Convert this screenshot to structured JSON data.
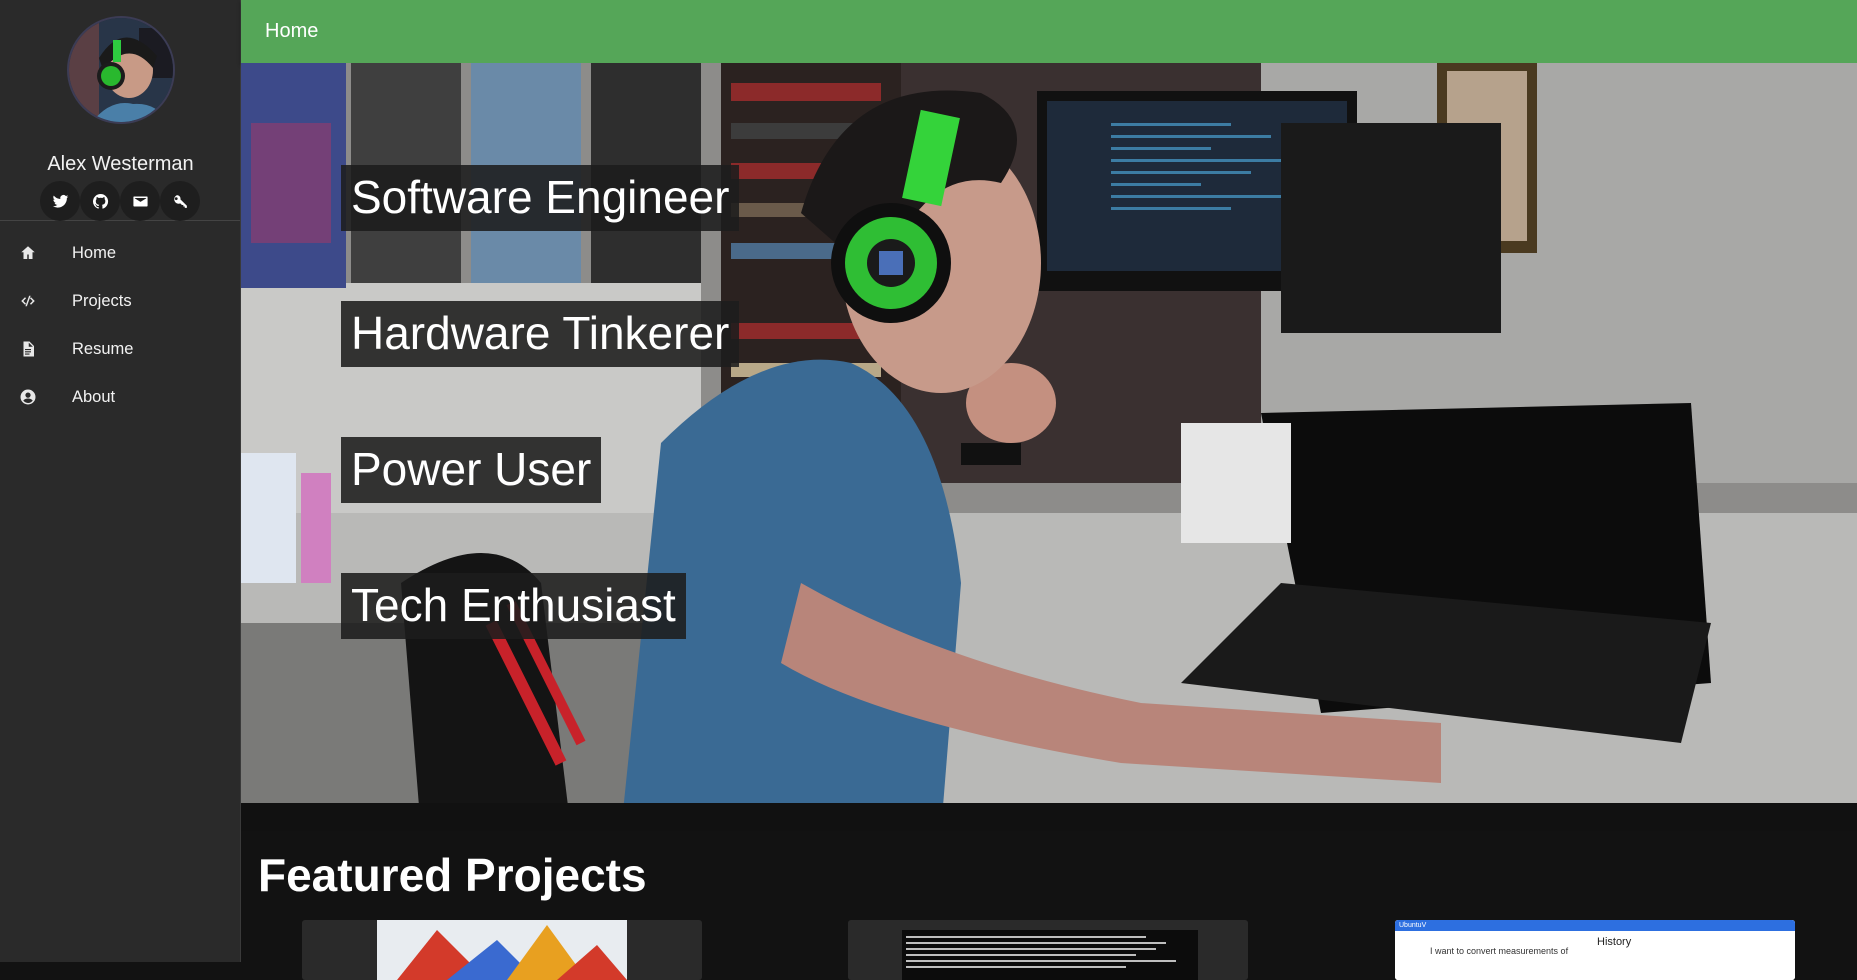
{
  "sidebar": {
    "profile": {
      "name": "Alex Westerman"
    },
    "social": [
      {
        "icon": "twitter-icon"
      },
      {
        "icon": "github-icon"
      },
      {
        "icon": "email-icon"
      },
      {
        "icon": "key-icon"
      }
    ],
    "nav": [
      {
        "label": "Home",
        "icon": "home-icon"
      },
      {
        "label": "Projects",
        "icon": "code-icon"
      },
      {
        "label": "Resume",
        "icon": "document-icon"
      },
      {
        "label": "About",
        "icon": "user-circle-icon"
      }
    ]
  },
  "header": {
    "title": "Home"
  },
  "hero": {
    "taglines": [
      "Software Engineer",
      "Hardware Tinkerer",
      "Power User",
      "Tech Enthusiast"
    ]
  },
  "featured": {
    "title": "Featured Projects",
    "cards": [
      {
        "thumb": "colorful-graphic"
      },
      {
        "thumb": "terminal-screenshot"
      },
      {
        "thumb": "converter-app-screenshot",
        "history_label": "History",
        "app_title": "UbuntuV",
        "prompt_text": "I want to convert measurements of"
      }
    ]
  },
  "colors": {
    "accent": "#55a658",
    "sidebar_bg": "#2a2a2a",
    "page_bg": "#121212"
  }
}
